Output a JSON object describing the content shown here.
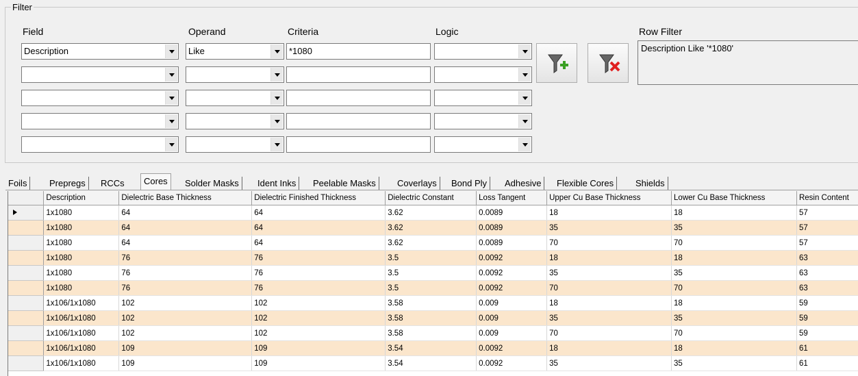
{
  "filter": {
    "legend": "Filter",
    "headers": {
      "field": "Field",
      "operand": "Operand",
      "criteria": "Criteria",
      "logic": "Logic",
      "row_filter": "Row Filter"
    },
    "rows": [
      {
        "field": "Description",
        "operand": "Like",
        "criteria": "*1080",
        "logic": ""
      },
      {
        "field": "",
        "operand": "",
        "criteria": "",
        "logic": ""
      },
      {
        "field": "",
        "operand": "",
        "criteria": "",
        "logic": ""
      },
      {
        "field": "",
        "operand": "",
        "criteria": "",
        "logic": ""
      },
      {
        "field": "",
        "operand": "",
        "criteria": "",
        "logic": ""
      }
    ],
    "row_filter_value": "Description Like '*1080'",
    "add_filter_icon": "funnel-plus-icon",
    "clear_filter_icon": "funnel-x-icon"
  },
  "tabs": [
    "Foils",
    "Prepregs",
    "RCCs",
    "Cores",
    "Solder Masks",
    "Ident Inks",
    "Peelable Masks",
    "Coverlays",
    "Bond Ply",
    "Adhesive",
    "Flexible Cores",
    "Shields"
  ],
  "active_tab": "Cores",
  "grid": {
    "columns": [
      "Description",
      "Dielectric Base Thickness",
      "Dielectric Finished Thickness",
      "Dielectric Constant",
      "Loss Tangent",
      "Upper Cu Base Thickness",
      "Lower Cu Base Thickness",
      "Resin Content"
    ],
    "rows": [
      [
        "1x1080",
        "64",
        "64",
        "3.62",
        "0.0089",
        "18",
        "18",
        "57"
      ],
      [
        "1x1080",
        "64",
        "64",
        "3.62",
        "0.0089",
        "35",
        "35",
        "57"
      ],
      [
        "1x1080",
        "64",
        "64",
        "3.62",
        "0.0089",
        "70",
        "70",
        "57"
      ],
      [
        "1x1080",
        "76",
        "76",
        "3.5",
        "0.0092",
        "18",
        "18",
        "63"
      ],
      [
        "1x1080",
        "76",
        "76",
        "3.5",
        "0.0092",
        "35",
        "35",
        "63"
      ],
      [
        "1x1080",
        "76",
        "76",
        "3.5",
        "0.0092",
        "70",
        "70",
        "63"
      ],
      [
        "1x106/1x1080",
        "102",
        "102",
        "3.58",
        "0.009",
        "18",
        "18",
        "59"
      ],
      [
        "1x106/1x1080",
        "102",
        "102",
        "3.58",
        "0.009",
        "35",
        "35",
        "59"
      ],
      [
        "1x106/1x1080",
        "102",
        "102",
        "3.58",
        "0.009",
        "70",
        "70",
        "59"
      ],
      [
        "1x106/1x1080",
        "109",
        "109",
        "3.54",
        "0.0092",
        "18",
        "18",
        "61"
      ],
      [
        "1x106/1x1080",
        "109",
        "109",
        "3.54",
        "0.0092",
        "35",
        "35",
        "61"
      ]
    ],
    "alt_row_color": "#fbe6cc",
    "selected_row": 0
  }
}
